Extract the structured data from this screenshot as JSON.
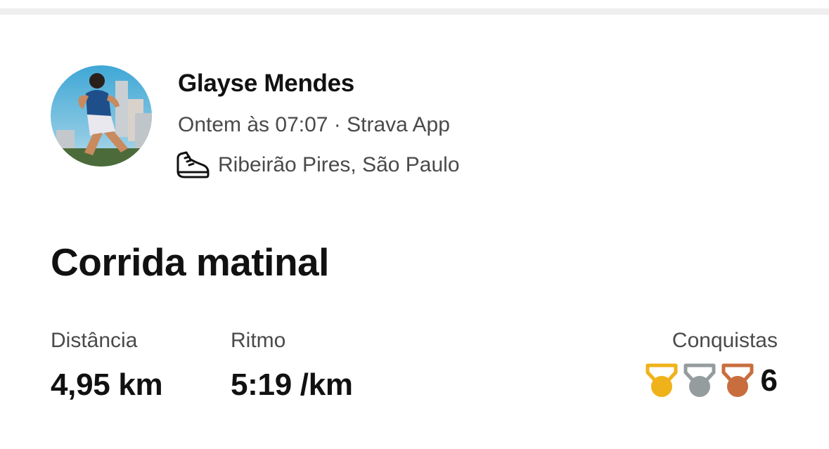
{
  "activity": {
    "athlete_name": "Glayse Mendes",
    "meta": "Ontem às 07:07 · Strava App",
    "location": "Ribeirão Pires, São Paulo",
    "title": "Corrida matinal",
    "icons": {
      "avatar": "avatar-photo",
      "sport": "running-shoe-icon"
    }
  },
  "stats": {
    "distance_label": "Distância",
    "distance_value": "4,95 km",
    "pace_label": "Ritmo",
    "pace_value": "5:19 /km",
    "achievements_label": "Conquistas",
    "achievements_count": "6",
    "medals": [
      {
        "type": "gold",
        "color": "#F0B21A"
      },
      {
        "type": "silver",
        "color": "#959C9E"
      },
      {
        "type": "bronze",
        "color": "#C86E3E"
      }
    ]
  }
}
